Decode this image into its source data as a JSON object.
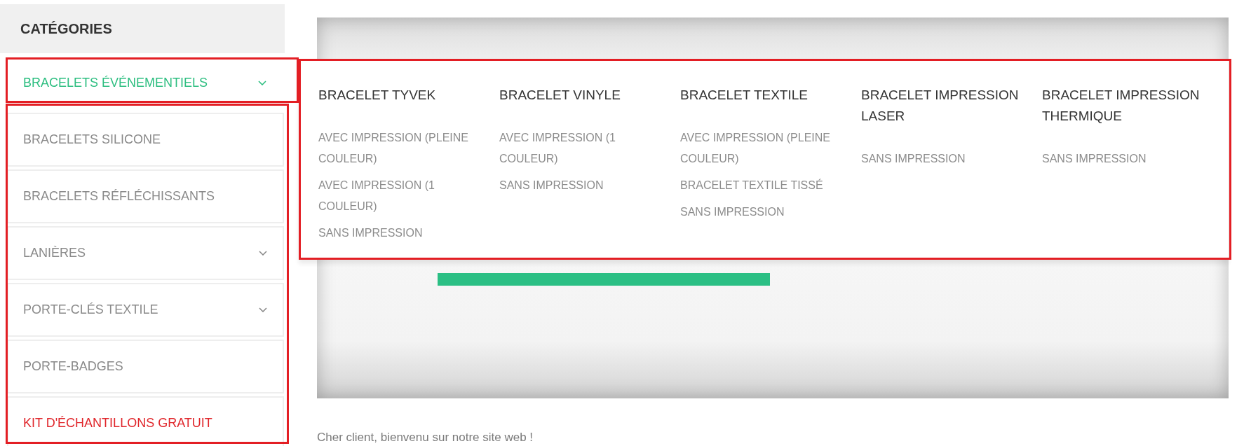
{
  "sidebar": {
    "title": "CATÉGORIES",
    "items": [
      {
        "label": "BRACELETS ÉVÉNEMENTIELS",
        "kind": "category",
        "selected": true,
        "has_submenu": true
      },
      {
        "label": "BRACELETS SILICONE",
        "kind": "category",
        "selected": false,
        "has_submenu": false
      },
      {
        "label": "BRACELETS RÉFLÉCHISSANTS",
        "kind": "category",
        "selected": false,
        "has_submenu": false
      },
      {
        "label": "LANIÈRES",
        "kind": "category",
        "selected": false,
        "has_submenu": true
      },
      {
        "label": "PORTE-CLÉS TEXTILE",
        "kind": "category",
        "selected": false,
        "has_submenu": true
      },
      {
        "label": "PORTE-BADGES",
        "kind": "category",
        "selected": false,
        "has_submenu": false
      },
      {
        "label": "KIT D'ÉCHANTILLONS GRATUIT",
        "kind": "offer",
        "selected": false,
        "has_submenu": false
      }
    ]
  },
  "mega_menu": {
    "columns": [
      {
        "title": "BRACELET TYVEK",
        "links": [
          "AVEC IMPRESSION (PLEINE COULEUR)",
          "AVEC IMPRESSION (1 COULEUR)",
          "SANS IMPRESSION"
        ]
      },
      {
        "title": "BRACELET VINYLE",
        "links": [
          "AVEC IMPRESSION (1 COULEUR)",
          "SANS IMPRESSION"
        ]
      },
      {
        "title": "BRACELET TEXTILE",
        "links": [
          "AVEC IMPRESSION (PLEINE COULEUR)",
          "BRACELET TEXTILE TISSÉ",
          "SANS IMPRESSION"
        ]
      },
      {
        "title": "BRACELET IMPRESSION LASER",
        "links": [
          "SANS IMPRESSION"
        ]
      },
      {
        "title": "BRACELET IMPRESSION THERMIQUE",
        "links": [
          "SANS IMPRESSION"
        ]
      }
    ]
  },
  "welcome_text": "Cher client, bienvenu sur notre site web !"
}
